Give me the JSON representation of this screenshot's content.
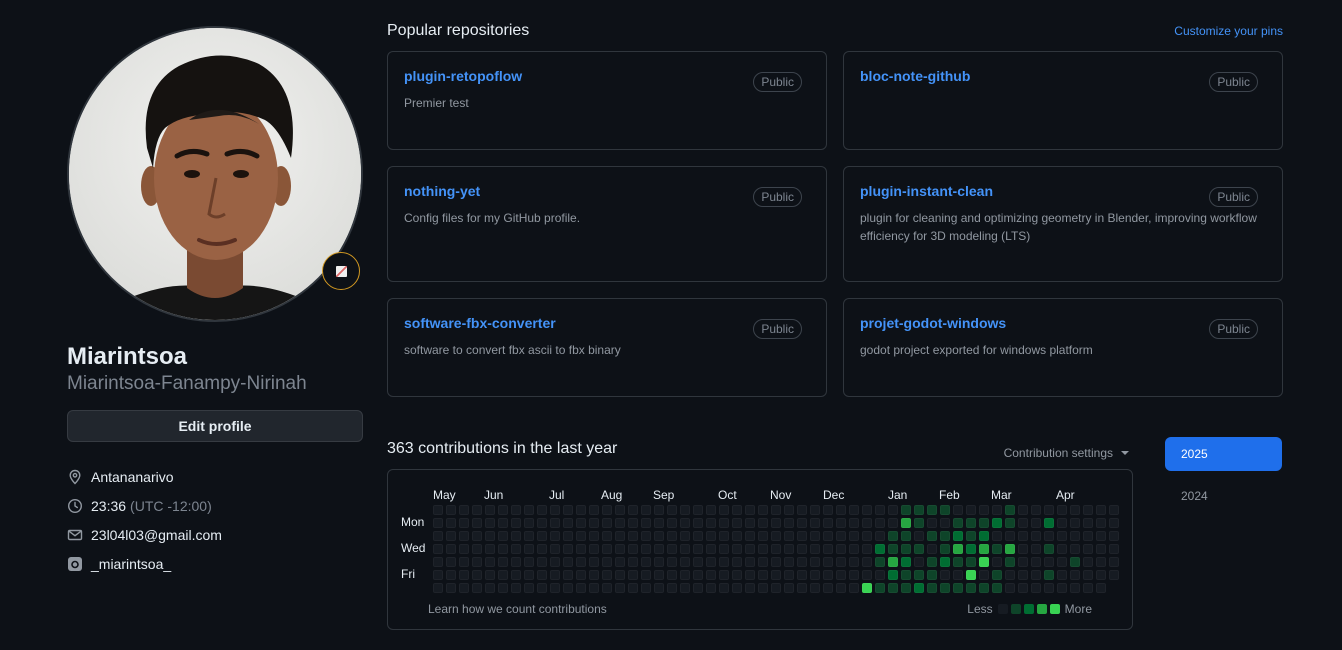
{
  "profile": {
    "name": "Miarintsoa",
    "login": "Miarintsoa-Fanampy-Nirinah",
    "edit_label": "Edit profile",
    "location": "Antananarivo",
    "time": "23:36",
    "timezone": "(UTC -12:00)",
    "email": "23l04l03@gmail.com",
    "social": "_miarintsoa_"
  },
  "pins": {
    "title": "Popular repositories",
    "customize_label": "Customize your pins",
    "items": [
      {
        "name": "plugin-retopoflow",
        "visibility": "Public",
        "description": "Premier test"
      },
      {
        "name": "bloc-note-github",
        "visibility": "Public",
        "description": ""
      },
      {
        "name": "nothing-yet",
        "visibility": "Public",
        "description": "Config files for my GitHub profile."
      },
      {
        "name": "plugin-instant-clean",
        "visibility": "Public",
        "description": "plugin for cleaning and optimizing geometry in Blender, improving workflow efficiency for 3D modeling (LTS)"
      },
      {
        "name": "software-fbx-converter",
        "visibility": "Public",
        "description": "software to convert fbx ascii to fbx binary"
      },
      {
        "name": "projet-godot-windows",
        "visibility": "Public",
        "description": "godot project exported for windows platform"
      }
    ]
  },
  "contributions": {
    "title": "363 contributions in the last year",
    "settings_label": "Contribution settings",
    "months": [
      "May",
      "Jun",
      "Jul",
      "Aug",
      "Sep",
      "Oct",
      "Nov",
      "Dec",
      "Jan",
      "Feb",
      "Mar",
      "Apr"
    ],
    "day_labels": [
      "Mon",
      "Wed",
      "Fri"
    ],
    "learn_label": "Learn how we count contributions",
    "legend_less": "Less",
    "legend_more": "More",
    "level_colors": [
      "#161b22",
      "#0e4429",
      "#006d32",
      "#26a641",
      "#39d353"
    ],
    "active_cells": [
      {
        "week": 33,
        "day": 6,
        "level": 4
      },
      {
        "week": 34,
        "day": 3,
        "level": 2
      },
      {
        "week": 34,
        "day": 4,
        "level": 1
      },
      {
        "week": 34,
        "day": 6,
        "level": 1
      },
      {
        "week": 35,
        "day": 2,
        "level": 1
      },
      {
        "week": 35,
        "day": 3,
        "level": 1
      },
      {
        "week": 35,
        "day": 4,
        "level": 3
      },
      {
        "week": 35,
        "day": 5,
        "level": 2
      },
      {
        "week": 35,
        "day": 6,
        "level": 1
      },
      {
        "week": 36,
        "day": 0,
        "level": 1
      },
      {
        "week": 36,
        "day": 1,
        "level": 3
      },
      {
        "week": 36,
        "day": 2,
        "level": 1
      },
      {
        "week": 36,
        "day": 3,
        "level": 1
      },
      {
        "week": 36,
        "day": 4,
        "level": 2
      },
      {
        "week": 36,
        "day": 5,
        "level": 1
      },
      {
        "week": 36,
        "day": 6,
        "level": 1
      },
      {
        "week": 37,
        "day": 0,
        "level": 1
      },
      {
        "week": 37,
        "day": 1,
        "level": 1
      },
      {
        "week": 37,
        "day": 3,
        "level": 1
      },
      {
        "week": 37,
        "day": 5,
        "level": 1
      },
      {
        "week": 37,
        "day": 6,
        "level": 2
      },
      {
        "week": 38,
        "day": 0,
        "level": 1
      },
      {
        "week": 38,
        "day": 2,
        "level": 1
      },
      {
        "week": 38,
        "day": 4,
        "level": 1
      },
      {
        "week": 38,
        "day": 5,
        "level": 1
      },
      {
        "week": 38,
        "day": 6,
        "level": 1
      },
      {
        "week": 39,
        "day": 0,
        "level": 1
      },
      {
        "week": 39,
        "day": 2,
        "level": 1
      },
      {
        "week": 39,
        "day": 3,
        "level": 1
      },
      {
        "week": 39,
        "day": 4,
        "level": 2
      },
      {
        "week": 39,
        "day": 6,
        "level": 1
      },
      {
        "week": 40,
        "day": 1,
        "level": 1
      },
      {
        "week": 40,
        "day": 2,
        "level": 2
      },
      {
        "week": 40,
        "day": 3,
        "level": 3
      },
      {
        "week": 40,
        "day": 4,
        "level": 1
      },
      {
        "week": 40,
        "day": 6,
        "level": 1
      },
      {
        "week": 41,
        "day": 1,
        "level": 1
      },
      {
        "week": 41,
        "day": 2,
        "level": 1
      },
      {
        "week": 41,
        "day": 3,
        "level": 2
      },
      {
        "week": 41,
        "day": 4,
        "level": 1
      },
      {
        "week": 41,
        "day": 5,
        "level": 4
      },
      {
        "week": 41,
        "day": 6,
        "level": 1
      },
      {
        "week": 42,
        "day": 1,
        "level": 1
      },
      {
        "week": 42,
        "day": 2,
        "level": 2
      },
      {
        "week": 42,
        "day": 3,
        "level": 3
      },
      {
        "week": 42,
        "day": 4,
        "level": 4
      },
      {
        "week": 42,
        "day": 6,
        "level": 1
      },
      {
        "week": 43,
        "day": 1,
        "level": 2
      },
      {
        "week": 43,
        "day": 3,
        "level": 1
      },
      {
        "week": 43,
        "day": 5,
        "level": 1
      },
      {
        "week": 43,
        "day": 6,
        "level": 1
      },
      {
        "week": 44,
        "day": 0,
        "level": 1
      },
      {
        "week": 44,
        "day": 1,
        "level": 1
      },
      {
        "week": 44,
        "day": 3,
        "level": 3
      },
      {
        "week": 44,
        "day": 4,
        "level": 1
      },
      {
        "week": 47,
        "day": 1,
        "level": 2
      },
      {
        "week": 47,
        "day": 3,
        "level": 1
      },
      {
        "week": 47,
        "day": 5,
        "level": 1
      },
      {
        "week": 49,
        "day": 4,
        "level": 1
      }
    ]
  },
  "years": {
    "items": [
      "2025",
      "2024"
    ],
    "active": "2025"
  },
  "colors": {
    "background": "#0d1117",
    "accent_link": "#4493f8",
    "year_active": "#1f6feb",
    "status_ring": "#d29922"
  }
}
